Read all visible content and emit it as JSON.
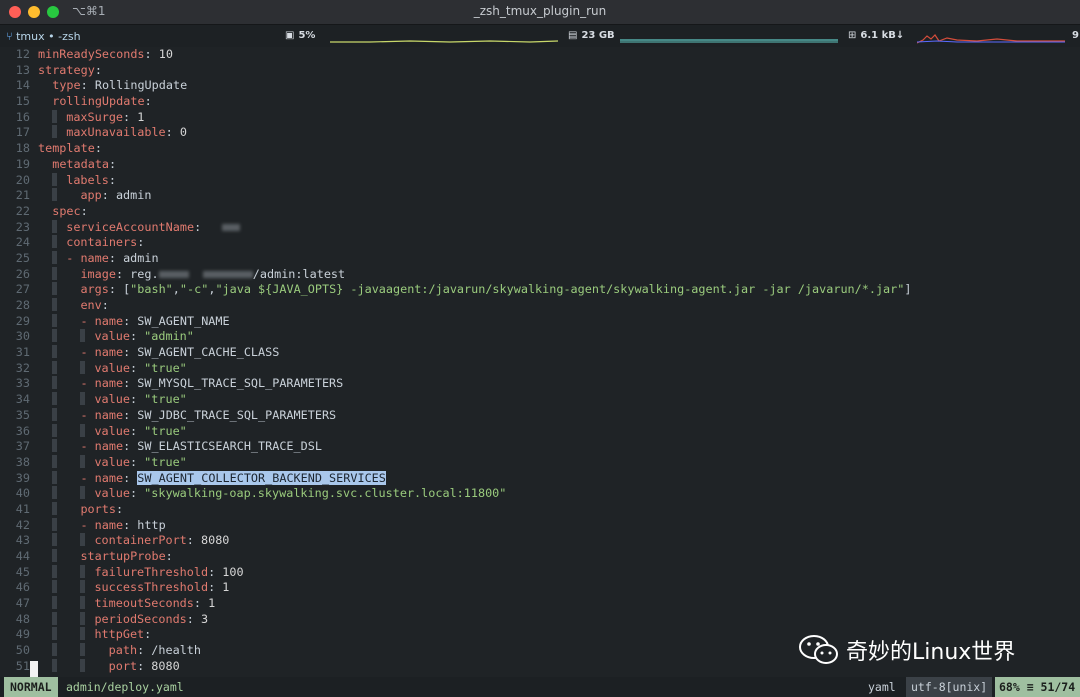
{
  "window": {
    "title": "_zsh_tmux_plugin_run",
    "shortcut": "⌥⌘1"
  },
  "status": {
    "tab": "tmux • -zsh",
    "cpu": "5%",
    "mem": "23 GB",
    "net": "6.1 kB↓",
    "extra": "9"
  },
  "lines": [
    {
      "n": "12",
      "html": "<span class=\"key\">minReadySeconds</span>: <span class=\"num\">10</span>"
    },
    {
      "n": "13",
      "html": "<span class=\"key\">strategy</span>:"
    },
    {
      "n": "14",
      "html": "  <span class=\"key\">type</span>: RollingUpdate"
    },
    {
      "n": "15",
      "html": "  <span class=\"key\">rollingUpdate</span>:"
    },
    {
      "n": "16",
      "html": "  <span class=\"guide\"></span><span class=\"key\">maxSurge</span>: <span class=\"num\">1</span>"
    },
    {
      "n": "17",
      "html": "  <span class=\"guide\"></span><span class=\"key\">maxUnavailable</span>: <span class=\"num\">0</span>"
    },
    {
      "n": "18",
      "html": "<span class=\"key\">template</span>:"
    },
    {
      "n": "19",
      "html": "  <span class=\"key\">metadata</span>:"
    },
    {
      "n": "20",
      "html": "  <span class=\"guide\"></span><span class=\"key\">labels</span>:"
    },
    {
      "n": "21",
      "html": "  <span class=\"guide\"></span>  <span class=\"key\">app</span>: admin"
    },
    {
      "n": "22",
      "html": "  <span class=\"key\">spec</span>:"
    },
    {
      "n": "23",
      "html": "  <span class=\"guide\"></span><span class=\"key\">serviceAccountName</span>:   <span class=\"blur\" style=\"width:18px\"></span>"
    },
    {
      "n": "24",
      "html": "  <span class=\"guide\"></span><span class=\"key\">containers</span>:"
    },
    {
      "n": "25",
      "html": "  <span class=\"guide\"></span><span class=\"dash\">-</span> <span class=\"key\">name</span>: admin"
    },
    {
      "n": "26",
      "html": "  <span class=\"guide\"></span>  <span class=\"key\">image</span>: reg.<span class=\"blur\" style=\"width:30px\"></span>  <span class=\"blur\" style=\"width:50px\"></span>/admin:latest"
    },
    {
      "n": "27",
      "html": "  <span class=\"guide\"></span>  <span class=\"key\">args</span>: [<span class=\"str\">\"bash\"</span>,<span class=\"str\">\"-c\"</span>,<span class=\"str\">\"java ${JAVA_OPTS} -javaagent:/javarun/skywalking-agent/skywalking-agent.jar -jar /javarun/*.jar\"</span>]"
    },
    {
      "n": "28",
      "html": "  <span class=\"guide\"></span>  <span class=\"key\">env</span>:"
    },
    {
      "n": "29",
      "html": "  <span class=\"guide\"></span>  <span class=\"dash\">-</span> <span class=\"key\">name</span>: SW_AGENT_NAME"
    },
    {
      "n": "30",
      "html": "  <span class=\"guide\"></span>  <span class=\"guide\"></span><span class=\"key\">value</span>: <span class=\"str\">\"admin\"</span>"
    },
    {
      "n": "31",
      "html": "  <span class=\"guide\"></span>  <span class=\"dash\">-</span> <span class=\"key\">name</span>: SW_AGENT_CACHE_CLASS"
    },
    {
      "n": "32",
      "html": "  <span class=\"guide\"></span>  <span class=\"guide\"></span><span class=\"key\">value</span>: <span class=\"str\">\"true\"</span>"
    },
    {
      "n": "33",
      "html": "  <span class=\"guide\"></span>  <span class=\"dash\">-</span> <span class=\"key\">name</span>: SW_MYSQL_TRACE_SQL_PARAMETERS"
    },
    {
      "n": "34",
      "html": "  <span class=\"guide\"></span>  <span class=\"guide\"></span><span class=\"key\">value</span>: <span class=\"str\">\"true\"</span>"
    },
    {
      "n": "35",
      "html": "  <span class=\"guide\"></span>  <span class=\"dash\">-</span> <span class=\"key\">name</span>: SW_JDBC_TRACE_SQL_PARAMETERS"
    },
    {
      "n": "36",
      "html": "  <span class=\"guide\"></span>  <span class=\"guide\"></span><span class=\"key\">value</span>: <span class=\"str\">\"true\"</span>"
    },
    {
      "n": "37",
      "html": "  <span class=\"guide\"></span>  <span class=\"dash\">-</span> <span class=\"key\">name</span>: SW_ELASTICSEARCH_TRACE_DSL"
    },
    {
      "n": "38",
      "html": "  <span class=\"guide\"></span>  <span class=\"guide\"></span><span class=\"key\">value</span>: <span class=\"str\">\"true\"</span>"
    },
    {
      "n": "39",
      "html": "  <span class=\"guide\"></span>  <span class=\"dash\">-</span> <span class=\"key\">name</span>: <span class=\"hl\">SW_AGENT_COLLECTOR_BACKEND_SERVICES</span>"
    },
    {
      "n": "40",
      "html": "  <span class=\"guide\"></span>  <span class=\"guide\"></span><span class=\"key\">value</span>: <span class=\"str\">\"skywalking-oap.skywalking.svc.cluster.local:11800\"</span>"
    },
    {
      "n": "41",
      "html": "  <span class=\"guide\"></span>  <span class=\"key\">ports</span>:"
    },
    {
      "n": "42",
      "html": "  <span class=\"guide\"></span>  <span class=\"dash\">-</span> <span class=\"key\">name</span>: http"
    },
    {
      "n": "43",
      "html": "  <span class=\"guide\"></span>  <span class=\"guide\"></span><span class=\"key\">containerPort</span>: <span class=\"num\">8080</span>"
    },
    {
      "n": "44",
      "html": "  <span class=\"guide\"></span>  <span class=\"key\">startupProbe</span>:"
    },
    {
      "n": "45",
      "html": "  <span class=\"guide\"></span>  <span class=\"guide\"></span><span class=\"key\">failureThreshold</span>: <span class=\"num\">100</span>"
    },
    {
      "n": "46",
      "html": "  <span class=\"guide\"></span>  <span class=\"guide\"></span><span class=\"key\">successThreshold</span>: <span class=\"num\">1</span>"
    },
    {
      "n": "47",
      "html": "  <span class=\"guide\"></span>  <span class=\"guide\"></span><span class=\"key\">timeoutSeconds</span>: <span class=\"num\">1</span>"
    },
    {
      "n": "48",
      "html": "  <span class=\"guide\"></span>  <span class=\"guide\"></span><span class=\"key\">periodSeconds</span>: <span class=\"num\">3</span>"
    },
    {
      "n": "49",
      "html": "  <span class=\"guide\"></span>  <span class=\"guide\"></span><span class=\"key\">httpGet</span>:"
    },
    {
      "n": "50",
      "html": "  <span class=\"guide\"></span>  <span class=\"guide\"></span>  <span class=\"key\">path</span>: /health"
    },
    {
      "n": "51",
      "html": "  <span class=\"guide\"></span>  <span class=\"guide\"></span>  <span class=\"key\">port</span>: <span class=\"num\">8080</span>"
    }
  ],
  "footer": {
    "mode": "NORMAL",
    "file": "admin/deploy.yaml",
    "filetype": "yaml",
    "encoding": "utf-8[unix]",
    "position": "68% ≡ 51/74"
  },
  "watermark": {
    "text": "奇妙的Linux世界"
  },
  "colors": {
    "key": "#e07a6f",
    "string": "#9acb7d",
    "highlight": "#a9c7eb",
    "mode_bg": "#9fbfa0"
  }
}
